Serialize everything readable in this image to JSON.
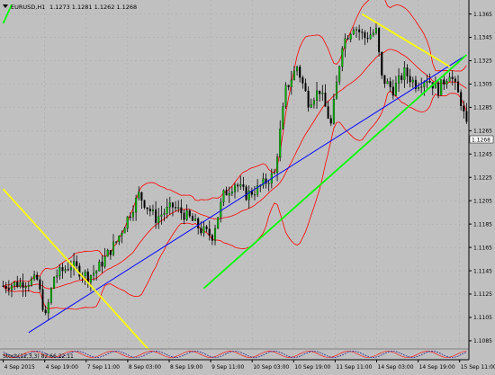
{
  "header": {
    "symbol_label": "EURUSD,H1",
    "ohlc": "1.1273 1.1281 1.1262 1.1268"
  },
  "indicator": {
    "label": "Stoch(12,3,3) 82.66 22.11"
  },
  "price_marker": "1.1268",
  "colors": {
    "background": "#c0c0c0",
    "grid": "#a8a8a8",
    "bull_candle": "#00c000",
    "bear_candle": "#000000",
    "bollinger": "#ff0000",
    "regression": "#0000ff",
    "trend_green": "#00ff00",
    "trend_yellow": "#ffff00"
  },
  "chart_data": {
    "type": "candlestick",
    "symbol": "EURUSD",
    "timeframe": "H1",
    "y_ticks": [
      "1.1365",
      "1.1345",
      "1.1325",
      "1.1305",
      "1.1285",
      "1.1265",
      "1.1245",
      "1.1225",
      "1.1205",
      "1.1185",
      "1.1165",
      "1.1145",
      "1.1125",
      "1.1105",
      "1.1085"
    ],
    "x_ticks": [
      "4 Sep 2015",
      "4 Sep 19:00",
      "7 Sep 11:00",
      "8 Sep 03:00",
      "8 Sep 19:00",
      "9 Sep 11:00",
      "10 Sep 03:00",
      "10 Sep 19:00",
      "11 Sep 11:00",
      "14 Sep 03:00",
      "14 Sep 19:00",
      "15 Sep 11:00"
    ],
    "ylim": [
      1.1078,
      1.1377
    ],
    "bars": 165,
    "price_path": [
      [
        0,
        1.1132
      ],
      [
        12,
        1.1137
      ],
      [
        15,
        1.1105
      ],
      [
        18,
        1.114
      ],
      [
        24,
        1.115
      ],
      [
        30,
        1.114
      ],
      [
        33,
        1.1145
      ],
      [
        40,
        1.117
      ],
      [
        48,
        1.121
      ],
      [
        54,
        1.119
      ],
      [
        60,
        1.12
      ],
      [
        66,
        1.119
      ],
      [
        70,
        1.118
      ],
      [
        74,
        1.1175
      ],
      [
        78,
        1.121
      ],
      [
        82,
        1.122
      ],
      [
        86,
        1.121
      ],
      [
        90,
        1.1215
      ],
      [
        96,
        1.1228
      ],
      [
        100,
        1.13
      ],
      [
        104,
        1.132
      ],
      [
        108,
        1.129
      ],
      [
        112,
        1.13
      ],
      [
        116,
        1.127
      ],
      [
        120,
        1.134
      ],
      [
        124,
        1.1355
      ],
      [
        128,
        1.1345
      ],
      [
        132,
        1.135
      ],
      [
        134,
        1.131
      ],
      [
        138,
        1.13
      ],
      [
        142,
        1.1315
      ],
      [
        146,
        1.1305
      ],
      [
        150,
        1.131
      ],
      [
        154,
        1.13
      ],
      [
        158,
        1.1315
      ],
      [
        162,
        1.129
      ],
      [
        164,
        1.1268
      ]
    ],
    "lines": [
      {
        "name": "",
        "color": "#0000ff",
        "from": [
          9,
          1.1092
        ],
        "to": [
          164,
          1.133
        ]
      },
      {
        "name": "",
        "color": "#00ff00",
        "from": [
          71,
          1.113
        ],
        "to": [
          164,
          1.133
        ]
      },
      {
        "name": "",
        "color": "#00ff00",
        "from": [
          0,
          1.1357
        ],
        "to": [
          3,
          1.1373
        ]
      },
      {
        "name": "",
        "color": "#ffff00",
        "from": [
          0,
          1.1215
        ],
        "to": [
          52,
          1.1076
        ]
      },
      {
        "name": "",
        "color": "#ffff00",
        "from": [
          127,
          1.1365
        ],
        "to": [
          158,
          1.132
        ]
      }
    ],
    "stochastic": {
      "k": 82.66,
      "d": 22.11,
      "params": "12,3,3"
    }
  }
}
